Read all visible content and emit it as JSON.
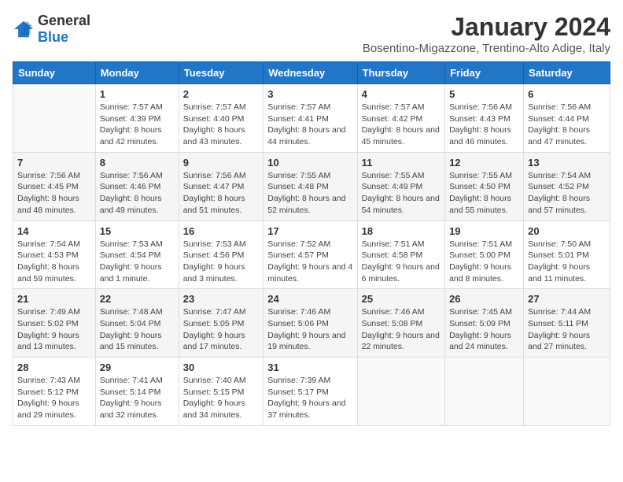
{
  "logo": {
    "general": "General",
    "blue": "Blue"
  },
  "title": "January 2024",
  "subtitle": "Bosentino-Migazzone, Trentino-Alto Adige, Italy",
  "days_of_week": [
    "Sunday",
    "Monday",
    "Tuesday",
    "Wednesday",
    "Thursday",
    "Friday",
    "Saturday"
  ],
  "weeks": [
    [
      {
        "day": "",
        "sunrise": "",
        "sunset": "",
        "daylight": ""
      },
      {
        "day": "1",
        "sunrise": "Sunrise: 7:57 AM",
        "sunset": "Sunset: 4:39 PM",
        "daylight": "Daylight: 8 hours and 42 minutes."
      },
      {
        "day": "2",
        "sunrise": "Sunrise: 7:57 AM",
        "sunset": "Sunset: 4:40 PM",
        "daylight": "Daylight: 8 hours and 43 minutes."
      },
      {
        "day": "3",
        "sunrise": "Sunrise: 7:57 AM",
        "sunset": "Sunset: 4:41 PM",
        "daylight": "Daylight: 8 hours and 44 minutes."
      },
      {
        "day": "4",
        "sunrise": "Sunrise: 7:57 AM",
        "sunset": "Sunset: 4:42 PM",
        "daylight": "Daylight: 8 hours and 45 minutes."
      },
      {
        "day": "5",
        "sunrise": "Sunrise: 7:56 AM",
        "sunset": "Sunset: 4:43 PM",
        "daylight": "Daylight: 8 hours and 46 minutes."
      },
      {
        "day": "6",
        "sunrise": "Sunrise: 7:56 AM",
        "sunset": "Sunset: 4:44 PM",
        "daylight": "Daylight: 8 hours and 47 minutes."
      }
    ],
    [
      {
        "day": "7",
        "sunrise": "Sunrise: 7:56 AM",
        "sunset": "Sunset: 4:45 PM",
        "daylight": "Daylight: 8 hours and 48 minutes."
      },
      {
        "day": "8",
        "sunrise": "Sunrise: 7:56 AM",
        "sunset": "Sunset: 4:46 PM",
        "daylight": "Daylight: 8 hours and 49 minutes."
      },
      {
        "day": "9",
        "sunrise": "Sunrise: 7:56 AM",
        "sunset": "Sunset: 4:47 PM",
        "daylight": "Daylight: 8 hours and 51 minutes."
      },
      {
        "day": "10",
        "sunrise": "Sunrise: 7:55 AM",
        "sunset": "Sunset: 4:48 PM",
        "daylight": "Daylight: 8 hours and 52 minutes."
      },
      {
        "day": "11",
        "sunrise": "Sunrise: 7:55 AM",
        "sunset": "Sunset: 4:49 PM",
        "daylight": "Daylight: 8 hours and 54 minutes."
      },
      {
        "day": "12",
        "sunrise": "Sunrise: 7:55 AM",
        "sunset": "Sunset: 4:50 PM",
        "daylight": "Daylight: 8 hours and 55 minutes."
      },
      {
        "day": "13",
        "sunrise": "Sunrise: 7:54 AM",
        "sunset": "Sunset: 4:52 PM",
        "daylight": "Daylight: 8 hours and 57 minutes."
      }
    ],
    [
      {
        "day": "14",
        "sunrise": "Sunrise: 7:54 AM",
        "sunset": "Sunset: 4:53 PM",
        "daylight": "Daylight: 8 hours and 59 minutes."
      },
      {
        "day": "15",
        "sunrise": "Sunrise: 7:53 AM",
        "sunset": "Sunset: 4:54 PM",
        "daylight": "Daylight: 9 hours and 1 minute."
      },
      {
        "day": "16",
        "sunrise": "Sunrise: 7:53 AM",
        "sunset": "Sunset: 4:56 PM",
        "daylight": "Daylight: 9 hours and 3 minutes."
      },
      {
        "day": "17",
        "sunrise": "Sunrise: 7:52 AM",
        "sunset": "Sunset: 4:57 PM",
        "daylight": "Daylight: 9 hours and 4 minutes."
      },
      {
        "day": "18",
        "sunrise": "Sunrise: 7:51 AM",
        "sunset": "Sunset: 4:58 PM",
        "daylight": "Daylight: 9 hours and 6 minutes."
      },
      {
        "day": "19",
        "sunrise": "Sunrise: 7:51 AM",
        "sunset": "Sunset: 5:00 PM",
        "daylight": "Daylight: 9 hours and 8 minutes."
      },
      {
        "day": "20",
        "sunrise": "Sunrise: 7:50 AM",
        "sunset": "Sunset: 5:01 PM",
        "daylight": "Daylight: 9 hours and 11 minutes."
      }
    ],
    [
      {
        "day": "21",
        "sunrise": "Sunrise: 7:49 AM",
        "sunset": "Sunset: 5:02 PM",
        "daylight": "Daylight: 9 hours and 13 minutes."
      },
      {
        "day": "22",
        "sunrise": "Sunrise: 7:48 AM",
        "sunset": "Sunset: 5:04 PM",
        "daylight": "Daylight: 9 hours and 15 minutes."
      },
      {
        "day": "23",
        "sunrise": "Sunrise: 7:47 AM",
        "sunset": "Sunset: 5:05 PM",
        "daylight": "Daylight: 9 hours and 17 minutes."
      },
      {
        "day": "24",
        "sunrise": "Sunrise: 7:46 AM",
        "sunset": "Sunset: 5:06 PM",
        "daylight": "Daylight: 9 hours and 19 minutes."
      },
      {
        "day": "25",
        "sunrise": "Sunrise: 7:46 AM",
        "sunset": "Sunset: 5:08 PM",
        "daylight": "Daylight: 9 hours and 22 minutes."
      },
      {
        "day": "26",
        "sunrise": "Sunrise: 7:45 AM",
        "sunset": "Sunset: 5:09 PM",
        "daylight": "Daylight: 9 hours and 24 minutes."
      },
      {
        "day": "27",
        "sunrise": "Sunrise: 7:44 AM",
        "sunset": "Sunset: 5:11 PM",
        "daylight": "Daylight: 9 hours and 27 minutes."
      }
    ],
    [
      {
        "day": "28",
        "sunrise": "Sunrise: 7:43 AM",
        "sunset": "Sunset: 5:12 PM",
        "daylight": "Daylight: 9 hours and 29 minutes."
      },
      {
        "day": "29",
        "sunrise": "Sunrise: 7:41 AM",
        "sunset": "Sunset: 5:14 PM",
        "daylight": "Daylight: 9 hours and 32 minutes."
      },
      {
        "day": "30",
        "sunrise": "Sunrise: 7:40 AM",
        "sunset": "Sunset: 5:15 PM",
        "daylight": "Daylight: 9 hours and 34 minutes."
      },
      {
        "day": "31",
        "sunrise": "Sunrise: 7:39 AM",
        "sunset": "Sunset: 5:17 PM",
        "daylight": "Daylight: 9 hours and 37 minutes."
      },
      {
        "day": "",
        "sunrise": "",
        "sunset": "",
        "daylight": ""
      },
      {
        "day": "",
        "sunrise": "",
        "sunset": "",
        "daylight": ""
      },
      {
        "day": "",
        "sunrise": "",
        "sunset": "",
        "daylight": ""
      }
    ]
  ]
}
